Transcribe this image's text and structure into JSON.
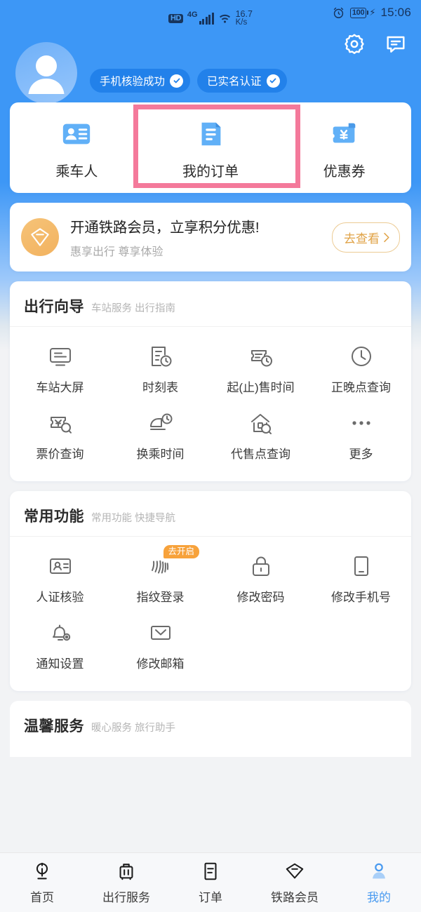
{
  "status_bar": {
    "hd": "HD",
    "network": "4G",
    "speed_value": "16.7",
    "speed_unit": "K/s",
    "battery": "100",
    "time": "15:06",
    "alarm_icon": "alarm-clock-icon",
    "charging_icon": "charging-bolt-icon",
    "gear_icon": "gear-icon",
    "message_icon": "message-icon"
  },
  "profile": {
    "avatar_icon": "avatar-placeholder-icon",
    "badges": [
      {
        "label": "手机核验成功",
        "icon": "check-circle-icon"
      },
      {
        "label": "已实名认证",
        "icon": "check-circle-icon"
      }
    ]
  },
  "quick_actions": {
    "items": [
      {
        "label": "乘车人",
        "icon": "id-card-icon",
        "highlighted": false
      },
      {
        "label": "我的订单",
        "icon": "order-document-icon",
        "highlighted": true
      },
      {
        "label": "优惠券",
        "icon": "coupon-wallet-icon",
        "highlighted": false
      }
    ],
    "highlight_color": "#f4799b"
  },
  "member_banner": {
    "icon": "diamond-icon",
    "title": "开通铁路会员，立享积分优惠!",
    "subtitle": "惠享出行 尊享体验",
    "button_label": "去查看",
    "accent_color": "#e0a245"
  },
  "sections": [
    {
      "title": "出行向导",
      "subtitle": "车站服务 出行指南",
      "items": [
        {
          "label": "车站大屏",
          "icon": "station-screen-icon"
        },
        {
          "label": "时刻表",
          "icon": "timetable-icon"
        },
        {
          "label": "起(止)售时间",
          "icon": "ticket-clock-icon"
        },
        {
          "label": "正晚点查询",
          "icon": "clock-icon"
        },
        {
          "label": "票价查询",
          "icon": "fare-search-icon"
        },
        {
          "label": "换乘时间",
          "icon": "transfer-time-icon"
        },
        {
          "label": "代售点查询",
          "icon": "agency-search-icon"
        },
        {
          "label": "更多",
          "icon": "more-dots-icon"
        }
      ]
    },
    {
      "title": "常用功能",
      "subtitle": "常用功能 快捷导航",
      "items": [
        {
          "label": "人证核验",
          "icon": "id-verify-icon"
        },
        {
          "label": "指纹登录",
          "icon": "fingerprint-icon",
          "tag": "去开启"
        },
        {
          "label": "修改密码",
          "icon": "lock-icon"
        },
        {
          "label": "修改手机号",
          "icon": "phone-icon"
        },
        {
          "label": "通知设置",
          "icon": "bell-settings-icon"
        },
        {
          "label": "修改邮箱",
          "icon": "envelope-icon"
        }
      ]
    },
    {
      "title": "温馨服务",
      "subtitle": "暖心服务 旅行助手",
      "items": []
    }
  ],
  "tabbar": {
    "items": [
      {
        "label": "首页",
        "icon": "railway-home-icon",
        "active": false
      },
      {
        "label": "出行服务",
        "icon": "luggage-icon",
        "active": false
      },
      {
        "label": "订单",
        "icon": "order-list-icon",
        "active": false
      },
      {
        "label": "铁路会员",
        "icon": "diamond-member-icon",
        "active": false
      },
      {
        "label": "我的",
        "icon": "person-icon",
        "active": true
      }
    ],
    "active_color": "#4a9bf0"
  }
}
